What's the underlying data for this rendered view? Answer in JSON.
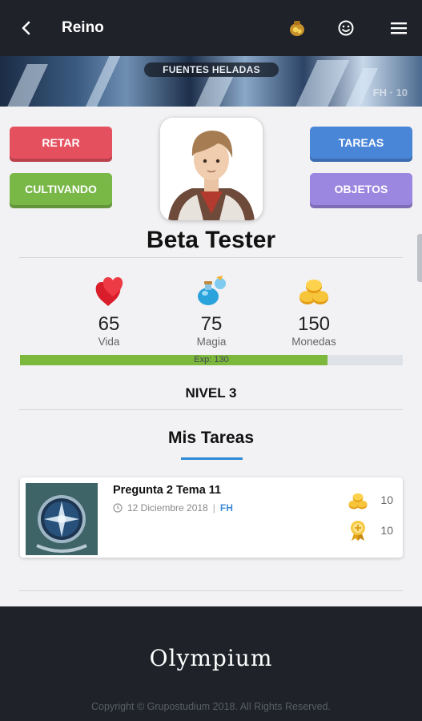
{
  "header": {
    "title": "Reino",
    "icons": [
      "back-arrow-icon",
      "coin-sack-icon",
      "smiley-icon",
      "menu-icon"
    ]
  },
  "banner": {
    "label": "FUENTES HELADAS",
    "corner_text": "FH · 10"
  },
  "actions": {
    "challenge": "RETAR",
    "cultivate": "CULTIVANDO",
    "tasks": "TAREAS",
    "items": "OBJETOS"
  },
  "profile": {
    "name": "Beta Tester"
  },
  "stats": [
    {
      "icon": "hearts-icon",
      "value": "65",
      "label": "Vida"
    },
    {
      "icon": "potion-icon",
      "value": "75",
      "label": "Magia"
    },
    {
      "icon": "coins-icon",
      "value": "150",
      "label": "Monedas"
    }
  ],
  "experience": {
    "text": "Exp: 130",
    "progress": 0.804
  },
  "level": "NIVEL 3",
  "tasks_section": {
    "title": "Mis Tareas",
    "items": [
      {
        "title": "Pregunta 2 Tema 11",
        "date": "12 Diciembre 2018",
        "separator": "|",
        "tag": "FH",
        "coins": "10",
        "xp": "10"
      }
    ]
  },
  "footer": {
    "logo": "Olympium",
    "copyright": "Copyright © Grupostudium 2018. All Rights Reserved."
  },
  "colors": {
    "topbar": "#1f2229",
    "retar": "#e5505f",
    "cultivando": "#79b747",
    "tareas": "#4a86d8",
    "objetos": "#9b86e0",
    "exp_fill": "#7bb83c",
    "accent": "#2c8ad6"
  }
}
